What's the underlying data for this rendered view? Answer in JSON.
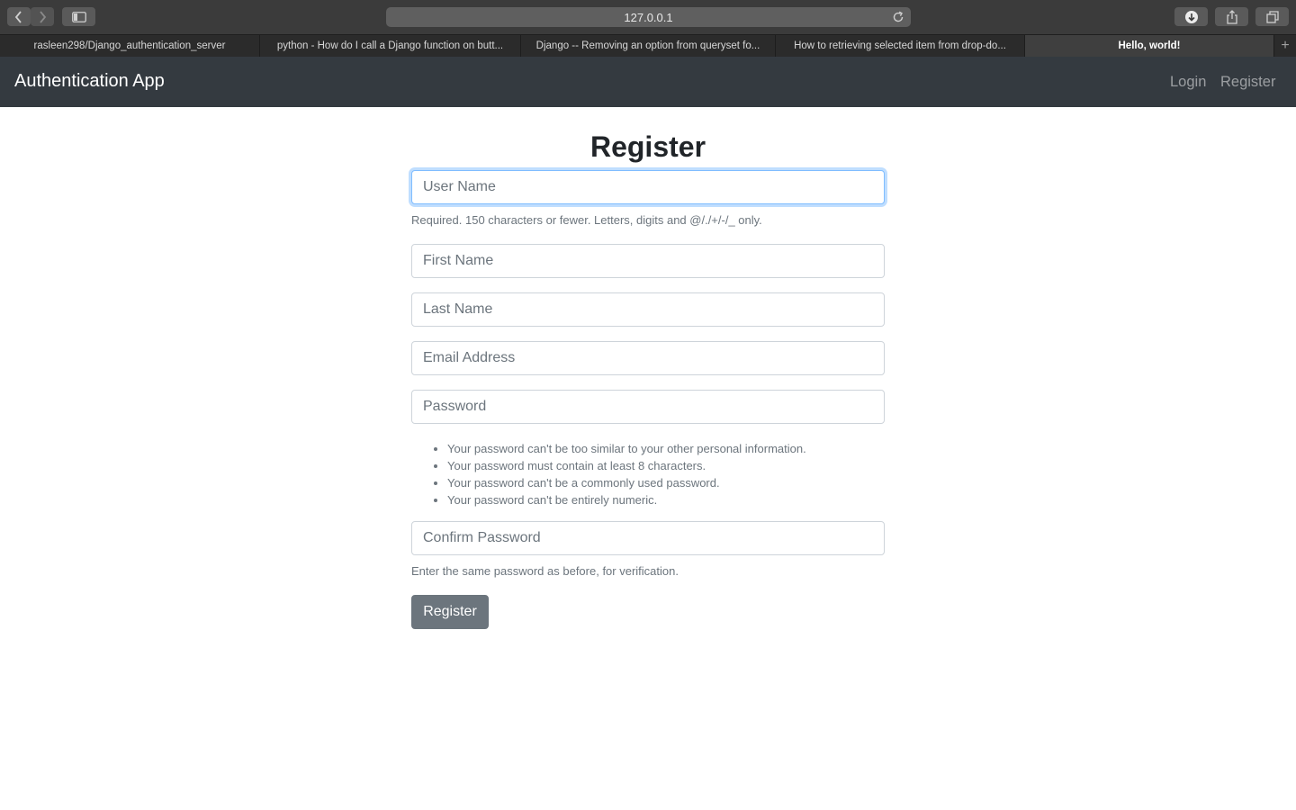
{
  "browser": {
    "url": "127.0.0.1",
    "tabs": [
      {
        "title": "rasleen298/Django_authentication_server"
      },
      {
        "title": "python - How do I call a Django function on butt..."
      },
      {
        "title": "Django -- Removing an option from queryset fo..."
      },
      {
        "title": "How to retrieving selected item from drop-do..."
      },
      {
        "title": "Hello, world!"
      }
    ],
    "add_tab": "+"
  },
  "navbar": {
    "brand": "Authentication App",
    "links": [
      "Login",
      "Register"
    ]
  },
  "form": {
    "title": "Register",
    "username_placeholder": "User Name",
    "username_help": "Required. 150 characters or fewer. Letters, digits and @/./+/-/_ only.",
    "first_name_placeholder": "First Name",
    "last_name_placeholder": "Last Name",
    "email_placeholder": "Email Address",
    "password_placeholder": "Password",
    "password_rules": [
      "Your password can't be too similar to your other personal information.",
      "Your password must contain at least 8 characters.",
      "Your password can't be a commonly used password.",
      "Your password can't be entirely numeric."
    ],
    "confirm_placeholder": "Confirm Password",
    "confirm_help": "Enter the same password as before, for verification.",
    "submit_label": "Register"
  },
  "colors": {
    "navbar_bg": "#343a40",
    "button_bg": "#6c757d",
    "focus_border": "#80bdff"
  }
}
